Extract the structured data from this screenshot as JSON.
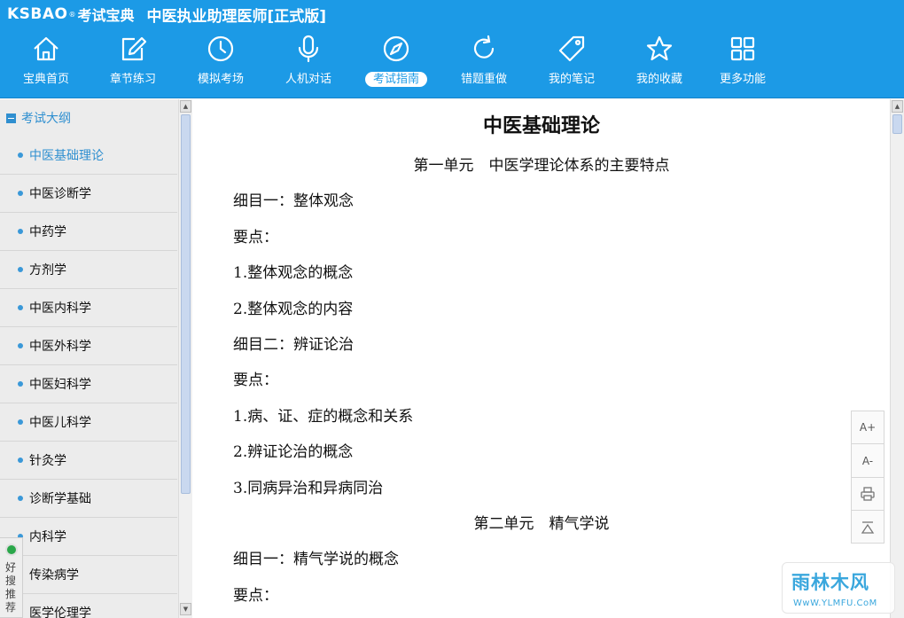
{
  "app": {
    "logo": "KSBAO",
    "logo_mark": "®",
    "logo_cn": "考试宝典",
    "title": "中医执业助理医师[正式版]"
  },
  "nav": {
    "items": [
      {
        "label": "宝典首页",
        "icon": "home-icon"
      },
      {
        "label": "章节练习",
        "icon": "edit-icon"
      },
      {
        "label": "模拟考场",
        "icon": "clock-icon"
      },
      {
        "label": "人机对话",
        "icon": "microphone-icon"
      },
      {
        "label": "考试指南",
        "icon": "compass-icon",
        "active": true
      },
      {
        "label": "错题重做",
        "icon": "refresh-icon"
      },
      {
        "label": "我的笔记",
        "icon": "tag-icon"
      },
      {
        "label": "我的收藏",
        "icon": "star-icon"
      },
      {
        "label": "更多功能",
        "icon": "grid-icon"
      }
    ]
  },
  "sidebar": {
    "header": "考试大纲",
    "items": [
      {
        "label": "中医基础理论",
        "active": true
      },
      {
        "label": "中医诊断学"
      },
      {
        "label": "中药学"
      },
      {
        "label": "方剂学"
      },
      {
        "label": "中医内科学"
      },
      {
        "label": "中医外科学"
      },
      {
        "label": "中医妇科学"
      },
      {
        "label": "中医儿科学"
      },
      {
        "label": "针灸学"
      },
      {
        "label": "诊断学基础"
      },
      {
        "label": "内科学"
      },
      {
        "label": "传染病学"
      },
      {
        "label": "医学伦理学"
      }
    ],
    "badge_text": "好搜推荐"
  },
  "content": {
    "title": "中医基础理论",
    "lines": [
      {
        "type": "heading",
        "text": "第一单元　中医学理论体系的主要特点"
      },
      {
        "type": "para",
        "text": "细目一：整体观念"
      },
      {
        "type": "para",
        "text": "要点："
      },
      {
        "type": "para",
        "text": "1.整体观念的概念"
      },
      {
        "type": "para",
        "text": "2.整体观念的内容"
      },
      {
        "type": "para",
        "text": "细目二：辨证论治"
      },
      {
        "type": "para",
        "text": "要点："
      },
      {
        "type": "para",
        "text": "1.病、证、症的概念和关系"
      },
      {
        "type": "para",
        "text": "2.辨证论治的概念"
      },
      {
        "type": "para",
        "text": "3.同病异治和异病同治"
      },
      {
        "type": "heading",
        "text": "第二单元　精气学说"
      },
      {
        "type": "para",
        "text": "细目一：精气学说的概念"
      },
      {
        "type": "para",
        "text": "要点："
      }
    ]
  },
  "tools": {
    "font_increase": "A+",
    "font_decrease": "A-",
    "print_icon": "printer-icon",
    "top_icon": "back-to-top-icon"
  },
  "watermark": {
    "name": "雨林木风",
    "url": "WwW.YLMFU.CoM"
  },
  "colors": {
    "header_bg": "#1c9ae6",
    "accent": "#2f8fd0",
    "sidebar_bg": "#ececec"
  }
}
